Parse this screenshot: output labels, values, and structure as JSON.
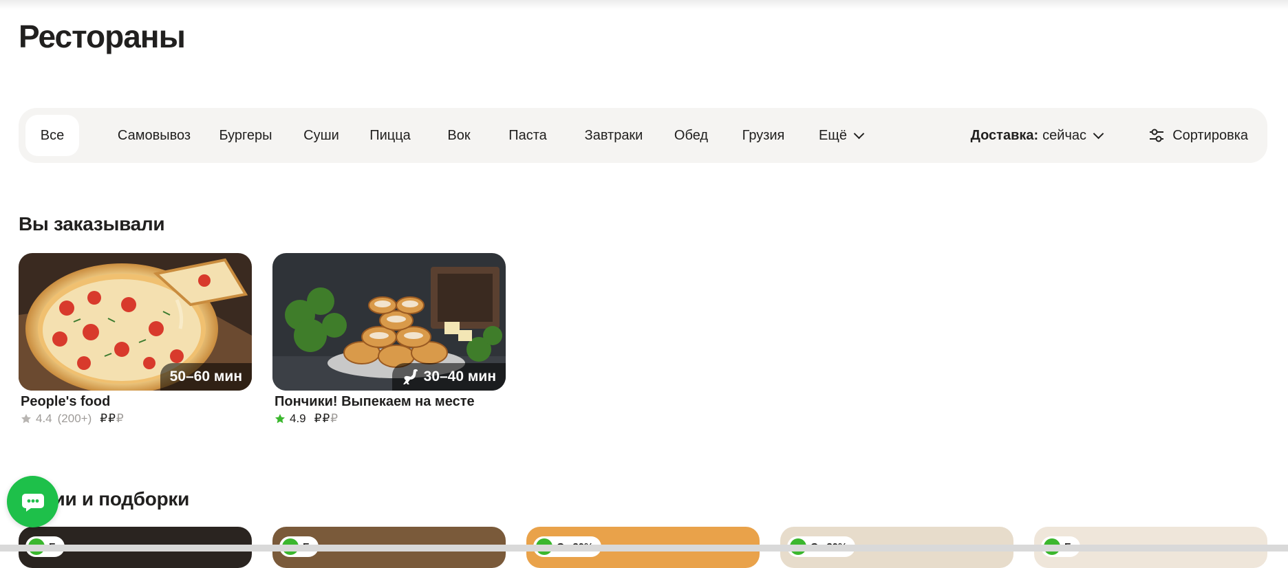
{
  "page": {
    "title": "Рестораны"
  },
  "filters": {
    "chips": [
      {
        "label": "Все",
        "active": true
      },
      {
        "label": "Самовывоз"
      },
      {
        "label": "Бургеры"
      },
      {
        "label": "Суши"
      },
      {
        "label": "Пицца"
      },
      {
        "label": "Вок"
      },
      {
        "label": "Паста"
      },
      {
        "label": "Завтраки"
      },
      {
        "label": "Обед"
      },
      {
        "label": "Грузия"
      }
    ],
    "more_label": "Ещё",
    "delivery_label": "Доставка:",
    "delivery_value": "сейчас",
    "sort_label": "Сортировка"
  },
  "ordered": {
    "title": "Вы заказывали",
    "cards": [
      {
        "name": "People's food",
        "rating": "4.4",
        "reviews": "(200+)",
        "price_active": "₽₽",
        "price_inactive": "₽",
        "time": "50–60 мин",
        "star_color": "#b8b5b2"
      },
      {
        "name": "Пончики! Выпекаем на месте",
        "rating": "4.9",
        "reviews": "",
        "price_active": "₽₽",
        "price_inactive": "₽",
        "time": "30–40 мин",
        "star_color": "#3bb72e",
        "fast_icon": "ostrich-icon"
      }
    ]
  },
  "collections": {
    "title": "Акции и подборки",
    "cards": [
      {
        "tag": "Б"
      },
      {
        "tag": "Б"
      },
      {
        "tag": "С...30%"
      },
      {
        "tag": "С...30%"
      },
      {
        "tag": "Б"
      }
    ]
  },
  "chat": {
    "icon": "chat-icon"
  }
}
